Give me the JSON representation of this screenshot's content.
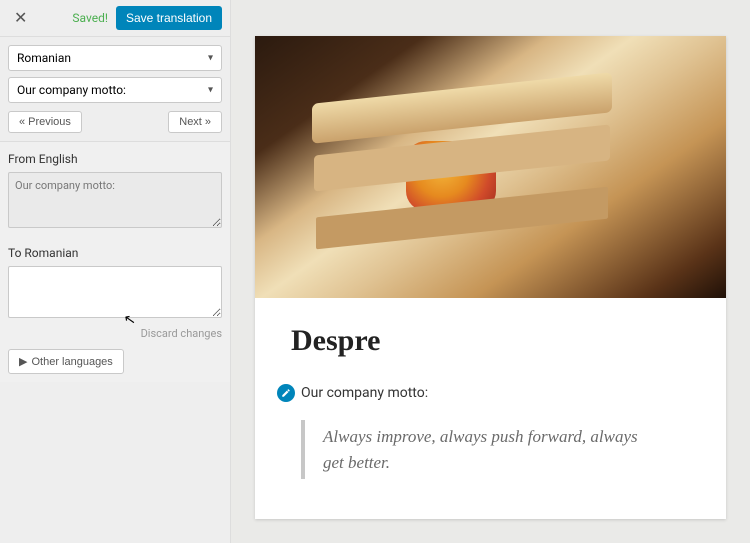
{
  "sidebar": {
    "saved_label": "Saved!",
    "save_button": "Save translation",
    "language_select": "Romanian",
    "string_select": "Our company motto:",
    "prev_label": "Previous",
    "next_label": "Next",
    "from_label": "From English",
    "from_value": "Our company motto:",
    "to_label": "To Romanian",
    "to_value": "",
    "discard_label": "Discard changes",
    "other_languages_label": "Other languages"
  },
  "preview": {
    "title": "Despre",
    "motto_label": "Our company motto:",
    "quote": "Always improve, always push forward, always get better."
  },
  "icons": {
    "close": "✕",
    "prev": "«",
    "next": "»",
    "play": "▶"
  }
}
